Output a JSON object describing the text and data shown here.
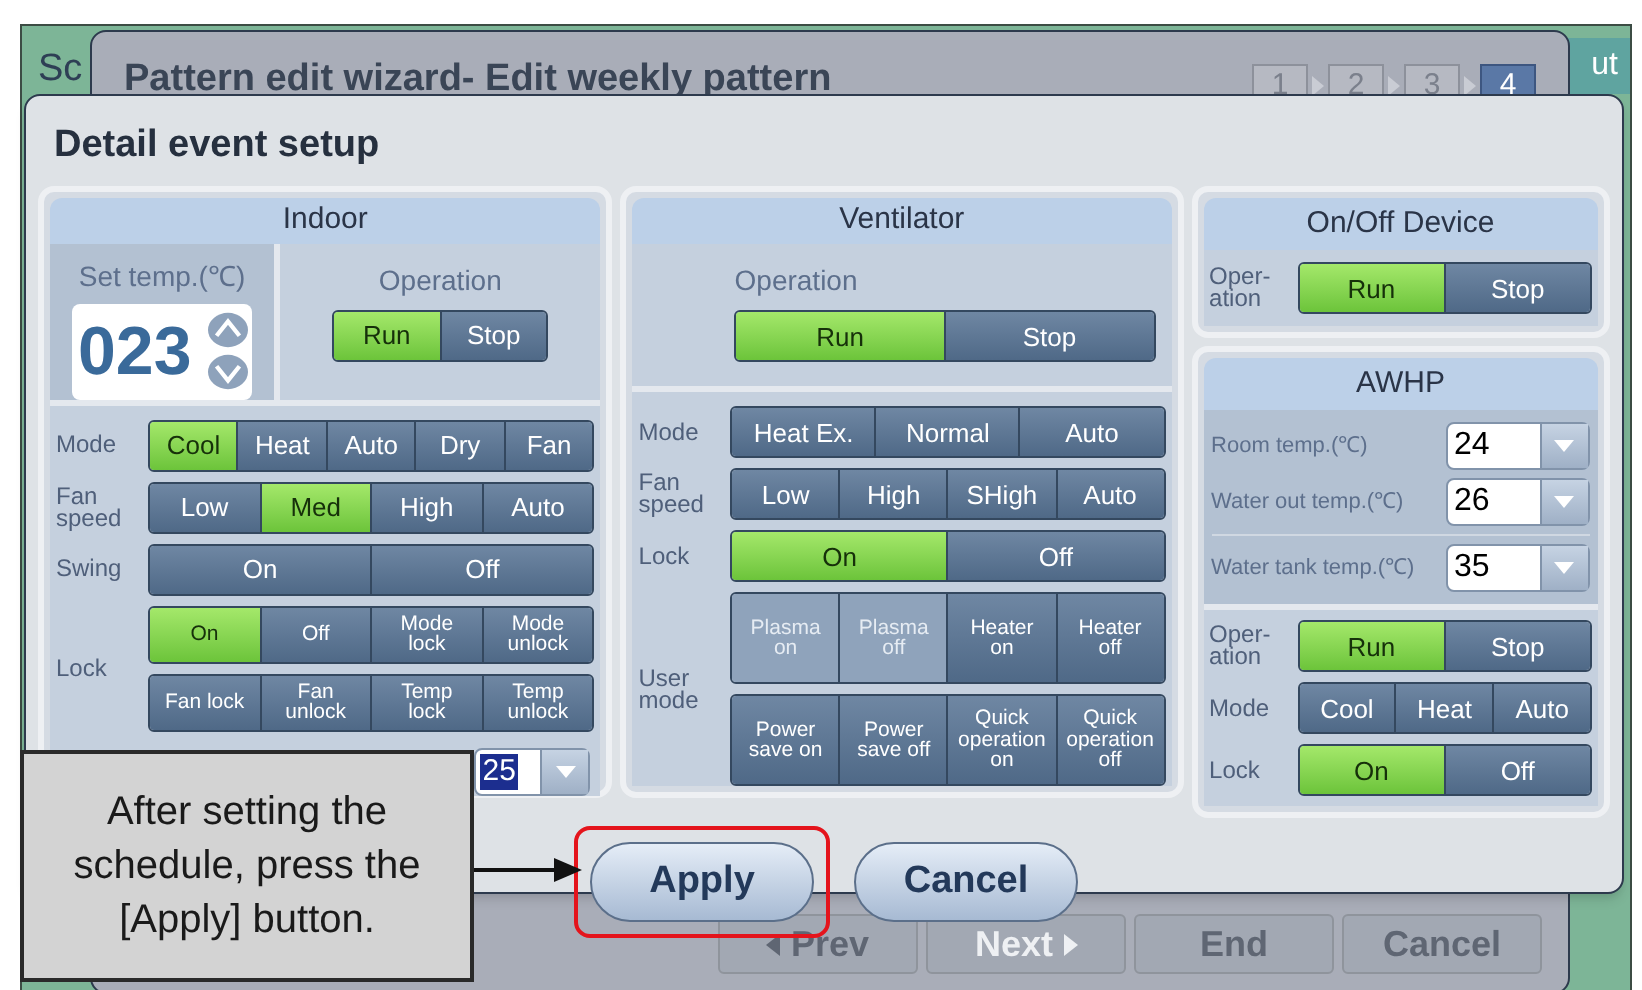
{
  "background_window": {
    "title_fragment": "Sc",
    "button_fragment": "ut"
  },
  "wizard": {
    "title": "Pattern edit wizard- Edit weekly pattern",
    "steps": [
      {
        "label": "1",
        "selected": false
      },
      {
        "label": "2",
        "selected": false
      },
      {
        "label": "3",
        "selected": false
      },
      {
        "label": "4",
        "selected": true
      }
    ],
    "buttons": [
      {
        "label": "Prev",
        "kind": "prev",
        "disabled": false
      },
      {
        "label": "Next",
        "kind": "next",
        "disabled": true
      },
      {
        "label": "End",
        "kind": "plain",
        "disabled": false
      },
      {
        "label": "Cancel",
        "kind": "plain",
        "disabled": false
      }
    ]
  },
  "dialog": {
    "title": "Detail event setup",
    "indoor": {
      "title": "Indoor",
      "set_temp": {
        "label": "Set temp.(℃)",
        "value": "023"
      },
      "operation": {
        "label": "Operation",
        "options": [
          {
            "label": "Run",
            "selected": true
          },
          {
            "label": "Stop",
            "selected": false
          }
        ]
      },
      "rows": [
        {
          "label": "Mode",
          "segments": [
            [
              {
                "label": "Cool",
                "selected": true
              },
              {
                "label": "Heat",
                "selected": false
              },
              {
                "label": "Auto",
                "selected": false
              },
              {
                "label": "Dry",
                "selected": false
              },
              {
                "label": "Fan",
                "selected": false
              }
            ]
          ]
        },
        {
          "label": "Fan speed",
          "segments": [
            [
              {
                "label": "Low",
                "selected": false
              },
              {
                "label": "Med",
                "selected": true
              },
              {
                "label": "High",
                "selected": false
              },
              {
                "label": "Auto",
                "selected": false
              }
            ]
          ]
        },
        {
          "label": "Swing",
          "segments": [
            [
              {
                "label": "On",
                "selected": false
              },
              {
                "label": "Off",
                "selected": false
              }
            ]
          ]
        },
        {
          "label": "Lock",
          "segments": [
            [
              {
                "label": "On",
                "selected": true
              },
              {
                "label": "Off",
                "selected": false
              },
              {
                "label": "Mode lock",
                "selected": false
              },
              {
                "label": "Mode unlock",
                "selected": false
              }
            ],
            [
              {
                "label": "Fan lock",
                "selected": false
              },
              {
                "label": "Fan unlock",
                "selected": false
              },
              {
                "label": "Temp lock",
                "selected": false
              },
              {
                "label": "Temp unlock",
                "selected": false
              }
            ]
          ]
        }
      ],
      "dropdown": {
        "value": "25"
      }
    },
    "ventilator": {
      "title": "Ventilator",
      "operation": {
        "label": "Operation",
        "options": [
          {
            "label": "Run",
            "selected": true
          },
          {
            "label": "Stop",
            "selected": false
          }
        ]
      },
      "rows": [
        {
          "label": "Mode",
          "segments": [
            [
              {
                "label": "Heat Ex.",
                "selected": false
              },
              {
                "label": "Normal",
                "selected": false
              },
              {
                "label": "Auto",
                "selected": false
              }
            ]
          ]
        },
        {
          "label": "Fan speed",
          "segments": [
            [
              {
                "label": "Low",
                "selected": false
              },
              {
                "label": "High",
                "selected": false
              },
              {
                "label": "SHigh",
                "selected": false
              },
              {
                "label": "Auto",
                "selected": false
              }
            ]
          ]
        },
        {
          "label": "Lock",
          "segments": [
            [
              {
                "label": "On",
                "selected": true
              },
              {
                "label": "Off",
                "selected": false
              }
            ]
          ]
        },
        {
          "label": "User mode",
          "segments": [
            [
              {
                "label": "Plasma on",
                "selected": false,
                "disabled": true
              },
              {
                "label": "Plasma off",
                "selected": false,
                "disabled": true
              },
              {
                "label": "Heater on",
                "selected": false,
                "disabled": false
              },
              {
                "label": "Heater off",
                "selected": false,
                "disabled": false
              }
            ],
            [
              {
                "label": "Power save on",
                "selected": false
              },
              {
                "label": "Power save off",
                "selected": false
              },
              {
                "label": "Quick operation on",
                "selected": false
              },
              {
                "label": "Quick operation off",
                "selected": false
              }
            ]
          ]
        }
      ]
    },
    "onoff": {
      "title": "On/Off Device",
      "rows": [
        {
          "label": "Oper- ation",
          "segments": [
            [
              {
                "label": "Run",
                "selected": true
              },
              {
                "label": "Stop",
                "selected": false
              }
            ]
          ]
        }
      ]
    },
    "awhp": {
      "title": "AWHP",
      "temps": [
        {
          "label": "Room temp.(℃)",
          "value": "24"
        },
        {
          "label": "Water out temp.(℃)",
          "value": "26"
        },
        {
          "label": "Water tank temp.(℃)",
          "value": "35"
        }
      ],
      "rows": [
        {
          "label": "Oper- ation",
          "segments": [
            [
              {
                "label": "Run",
                "selected": true
              },
              {
                "label": "Stop",
                "selected": false
              }
            ]
          ]
        },
        {
          "label": "Mode",
          "segments": [
            [
              {
                "label": "Cool",
                "selected": false
              },
              {
                "label": "Heat",
                "selected": false
              },
              {
                "label": "Auto",
                "selected": false
              }
            ]
          ]
        },
        {
          "label": "Lock",
          "segments": [
            [
              {
                "label": "On",
                "selected": true
              },
              {
                "label": "Off",
                "selected": false
              }
            ]
          ]
        }
      ]
    },
    "buttons": [
      {
        "label": "Apply",
        "highlighted": true
      },
      {
        "label": "Cancel",
        "highlighted": false
      }
    ]
  },
  "callout": {
    "text": "After setting the schedule, press the [Apply] button."
  }
}
